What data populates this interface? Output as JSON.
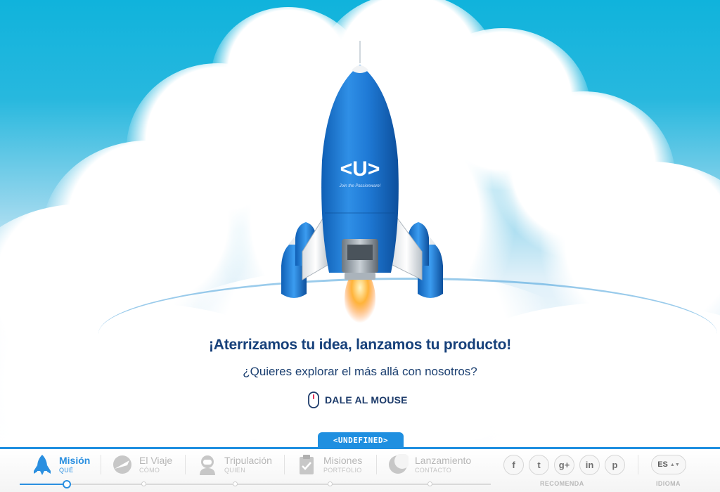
{
  "hero": {
    "headline": "¡Aterrizamos tu idea, lanzamos tu producto!",
    "subheadline": "¿Quieres explorar el más allá con nosotros?",
    "cta_label": "DALE AL MOUSE",
    "rocket_logo": "<U>",
    "rocket_tagline": "Join the Passionware!"
  },
  "brand_tab": "<UNDEFINED>",
  "nav": [
    {
      "title": "Misión",
      "sub": "QUÉ",
      "icon": "rocket-icon",
      "active": true
    },
    {
      "title": "El Viaje",
      "sub": "CÓMO",
      "icon": "airplane-icon",
      "active": false
    },
    {
      "title": "Tripulación",
      "sub": "QUIEN",
      "icon": "astronaut-icon",
      "active": false
    },
    {
      "title": "Misiones",
      "sub": "PORTFOLIO",
      "icon": "clipboard-icon",
      "active": false
    },
    {
      "title": "Lanzamiento",
      "sub": "CONTACTO",
      "icon": "moon-icon",
      "active": false
    }
  ],
  "progress": {
    "value_fraction": 0.1
  },
  "social": {
    "label": "RECOMENDA",
    "buttons": [
      {
        "glyph": "f",
        "icon": "facebook-icon"
      },
      {
        "glyph": "t",
        "icon": "twitter-icon"
      },
      {
        "glyph": "g+",
        "icon": "google-plus-icon"
      },
      {
        "glyph": "in",
        "icon": "linkedin-icon"
      },
      {
        "glyph": "p",
        "icon": "pinterest-icon"
      }
    ]
  },
  "language": {
    "label": "IDIOMA",
    "value": "ES"
  },
  "colors": {
    "accent": "#1f8fe0",
    "headline": "#16407a",
    "sky": "#10b3dc"
  }
}
